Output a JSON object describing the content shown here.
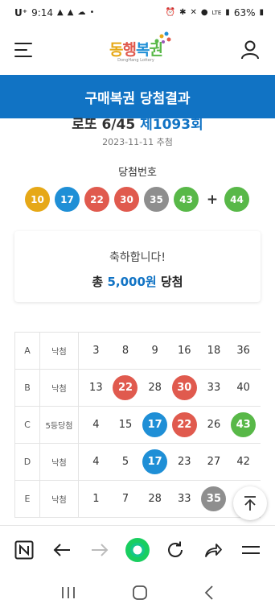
{
  "status_bar": {
    "carrier": "U⁺",
    "time": "9:14",
    "battery": "63%",
    "network": "LTE"
  },
  "header": {
    "logo_text": "동행복권",
    "logo_sub": "DongHang Lottery"
  },
  "page": {
    "title": "구매복권 당첨결과",
    "draw_name": "로또 6/45",
    "draw_round": "제1093회",
    "draw_date": "2023-11-11 추첨",
    "winning_label": "당첨번호"
  },
  "winning_numbers": [
    {
      "value": "10",
      "color": "#e6a817"
    },
    {
      "value": "17",
      "color": "#1f8fd6"
    },
    {
      "value": "22",
      "color": "#e05a4e"
    },
    {
      "value": "30",
      "color": "#e05a4e"
    },
    {
      "value": "35",
      "color": "#8e8e8e"
    },
    {
      "value": "43",
      "color": "#58b848"
    }
  ],
  "plus_sign": "+",
  "bonus_number": {
    "value": "44",
    "color": "#58b848"
  },
  "result": {
    "message": "축하합니다!",
    "prize_prefix": "총",
    "prize_amount": "5,000원",
    "prize_suffix": "당첨"
  },
  "tickets": [
    {
      "label": "A",
      "result": "낙첨",
      "numbers": [
        {
          "v": "3",
          "hit": false
        },
        {
          "v": "8",
          "hit": false
        },
        {
          "v": "9",
          "hit": false
        },
        {
          "v": "16",
          "hit": false
        },
        {
          "v": "18",
          "hit": false
        },
        {
          "v": "36",
          "hit": false
        }
      ]
    },
    {
      "label": "B",
      "result": "낙첨",
      "numbers": [
        {
          "v": "13",
          "hit": false
        },
        {
          "v": "22",
          "hit": true,
          "color": "#e05a4e"
        },
        {
          "v": "28",
          "hit": false
        },
        {
          "v": "30",
          "hit": true,
          "color": "#e05a4e"
        },
        {
          "v": "33",
          "hit": false
        },
        {
          "v": "40",
          "hit": false
        }
      ]
    },
    {
      "label": "C",
      "result": "5등당첨",
      "numbers": [
        {
          "v": "4",
          "hit": false
        },
        {
          "v": "15",
          "hit": false
        },
        {
          "v": "17",
          "hit": true,
          "color": "#1f8fd6"
        },
        {
          "v": "22",
          "hit": true,
          "color": "#e05a4e"
        },
        {
          "v": "26",
          "hit": false
        },
        {
          "v": "43",
          "hit": true,
          "color": "#58b848"
        }
      ]
    },
    {
      "label": "D",
      "result": "낙첨",
      "numbers": [
        {
          "v": "4",
          "hit": false
        },
        {
          "v": "5",
          "hit": false
        },
        {
          "v": "17",
          "hit": true,
          "color": "#1f8fd6"
        },
        {
          "v": "23",
          "hit": false
        },
        {
          "v": "27",
          "hit": false
        },
        {
          "v": "42",
          "hit": false
        }
      ]
    },
    {
      "label": "E",
      "result": "낙첨",
      "numbers": [
        {
          "v": "1",
          "hit": false
        },
        {
          "v": "7",
          "hit": false
        },
        {
          "v": "28",
          "hit": false
        },
        {
          "v": "33",
          "hit": false
        },
        {
          "v": "35",
          "hit": true,
          "color": "#8e8e8e"
        },
        {
          "v": "",
          "hit": false
        }
      ]
    }
  ],
  "icons": {
    "menu": "hamburger-icon",
    "user": "user-icon",
    "scroll_top": "arrow-up-to-top-icon",
    "browser": [
      "naver-n-icon",
      "back-arrow-icon",
      "forward-arrow-icon",
      "home-green-icon",
      "refresh-icon",
      "share-icon",
      "menu-icon"
    ],
    "nav": [
      "recent-apps-icon",
      "home-icon",
      "back-icon"
    ]
  }
}
